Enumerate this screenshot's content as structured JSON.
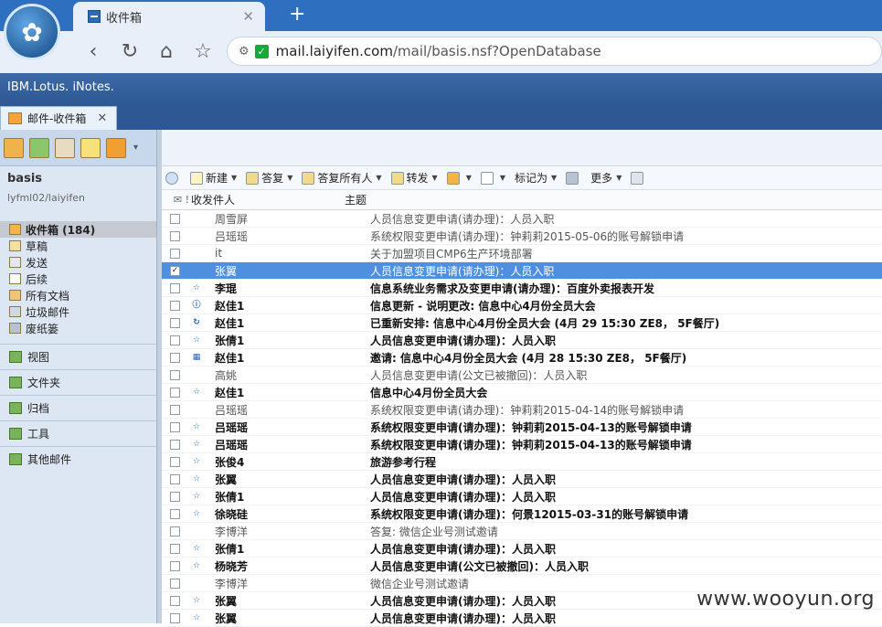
{
  "browser": {
    "tab_title": "收件箱",
    "url_host": "mail.laiyifen.com",
    "url_path": "/mail/basis.nsf?OpenDatabase"
  },
  "brand": "IBM.Lotus. iNotes.",
  "app_tab": {
    "label": "邮件-收件箱"
  },
  "sidebar": {
    "db_name": "basis",
    "db_path": "lyfml02/laiyifen",
    "folders": [
      {
        "label": "收件箱 (184)",
        "selected": true
      },
      {
        "label": "草稿"
      },
      {
        "label": "发送"
      },
      {
        "label": "后续"
      },
      {
        "label": "所有文档"
      },
      {
        "label": "垃圾邮件"
      },
      {
        "label": "废纸篓"
      }
    ],
    "sections": [
      "视图",
      "文件夹",
      "归档",
      "工具",
      "其他邮件"
    ]
  },
  "toolbar": {
    "new": "新建",
    "reply": "答复",
    "reply_all": "答复所有人",
    "forward": "转发",
    "mark_as": "标记为",
    "more": "更多"
  },
  "columns": {
    "sender": "收发件人",
    "subject": "主题"
  },
  "rows": [
    {
      "sender": "周雪屏",
      "subject": "人员信息变更申请(请办理)：人员入职",
      "unread": false,
      "icon": ""
    },
    {
      "sender": "吕瑶瑶",
      "subject": "系统权限变更申请(请办理)：钟莉莉2015-05-06的账号解锁申请",
      "unread": false,
      "icon": ""
    },
    {
      "sender": "it",
      "subject": "关于加盟项目CMP6生产环境部署",
      "unread": false,
      "icon": ""
    },
    {
      "sender": "张翼",
      "subject": "人员信息变更申请(请办理)：人员入职",
      "unread": false,
      "icon": "",
      "selected": true
    },
    {
      "sender": "李琨",
      "subject": "信息系统业务需求及变更申请(请办理)：百度外卖报表开发",
      "unread": true,
      "icon": "☆"
    },
    {
      "sender": "赵佳1",
      "subject": "信息更新 - 说明更改: 信息中心4月份全员大会",
      "unread": true,
      "icon": "ⓘ"
    },
    {
      "sender": "赵佳1",
      "subject": "已重新安排: 信息中心4月份全员大会 (4月 29 15:30 ZE8， 5F餐厅)",
      "unread": true,
      "icon": "↻"
    },
    {
      "sender": "张倩1",
      "subject": "人员信息变更申请(请办理)：人员入职",
      "unread": true,
      "icon": "☆"
    },
    {
      "sender": "赵佳1",
      "subject": "邀请: 信息中心4月份全员大会 (4月 28 15:30 ZE8， 5F餐厅)",
      "unread": true,
      "icon": "▦"
    },
    {
      "sender": "高姚",
      "subject": "人员信息变更申请(公文已被撤回)：人员入职",
      "unread": false,
      "icon": ""
    },
    {
      "sender": "赵佳1",
      "subject": "信息中心4月份全员大会",
      "unread": true,
      "icon": "☆"
    },
    {
      "sender": "吕瑶瑶",
      "subject": "系统权限变更申请(请办理)：钟莉莉2015-04-14的账号解锁申请",
      "unread": false,
      "icon": ""
    },
    {
      "sender": "吕瑶瑶",
      "subject": "系统权限变更申请(请办理)：钟莉莉2015-04-13的账号解锁申请",
      "unread": true,
      "icon": "☆"
    },
    {
      "sender": "吕瑶瑶",
      "subject": "系统权限变更申请(请办理)：钟莉莉2015-04-13的账号解锁申请",
      "unread": true,
      "icon": "☆"
    },
    {
      "sender": "张俊4",
      "subject": "旅游参考行程",
      "unread": true,
      "icon": "☆"
    },
    {
      "sender": "张翼",
      "subject": "人员信息变更申请(请办理)：人员入职",
      "unread": true,
      "icon": "☆"
    },
    {
      "sender": "张倩1",
      "subject": "人员信息变更申请(请办理)：人员入职",
      "unread": true,
      "icon": "☆"
    },
    {
      "sender": "徐晓硅",
      "subject": "系统权限变更申请(请办理)：何景12015-03-31的账号解锁申请",
      "unread": true,
      "icon": "☆"
    },
    {
      "sender": "李博洋",
      "subject": "答复: 微信企业号测试邀请",
      "unread": false,
      "icon": ""
    },
    {
      "sender": "张倩1",
      "subject": "人员信息变更申请(请办理)：人员入职",
      "unread": true,
      "icon": "☆"
    },
    {
      "sender": "杨晓芳",
      "subject": "人员信息变更申请(公文已被撤回)：人员入职",
      "unread": true,
      "icon": "☆"
    },
    {
      "sender": "李博洋",
      "subject": "微信企业号测试邀请",
      "unread": false,
      "icon": ""
    },
    {
      "sender": "张翼",
      "subject": "人员信息变更申请(请办理)：人员入职",
      "unread": true,
      "icon": "☆"
    },
    {
      "sender": "张翼",
      "subject": "人员信息变更申请(请办理)：人员入职",
      "unread": true,
      "icon": "☆"
    }
  ],
  "watermark": "www.wooyun.org"
}
